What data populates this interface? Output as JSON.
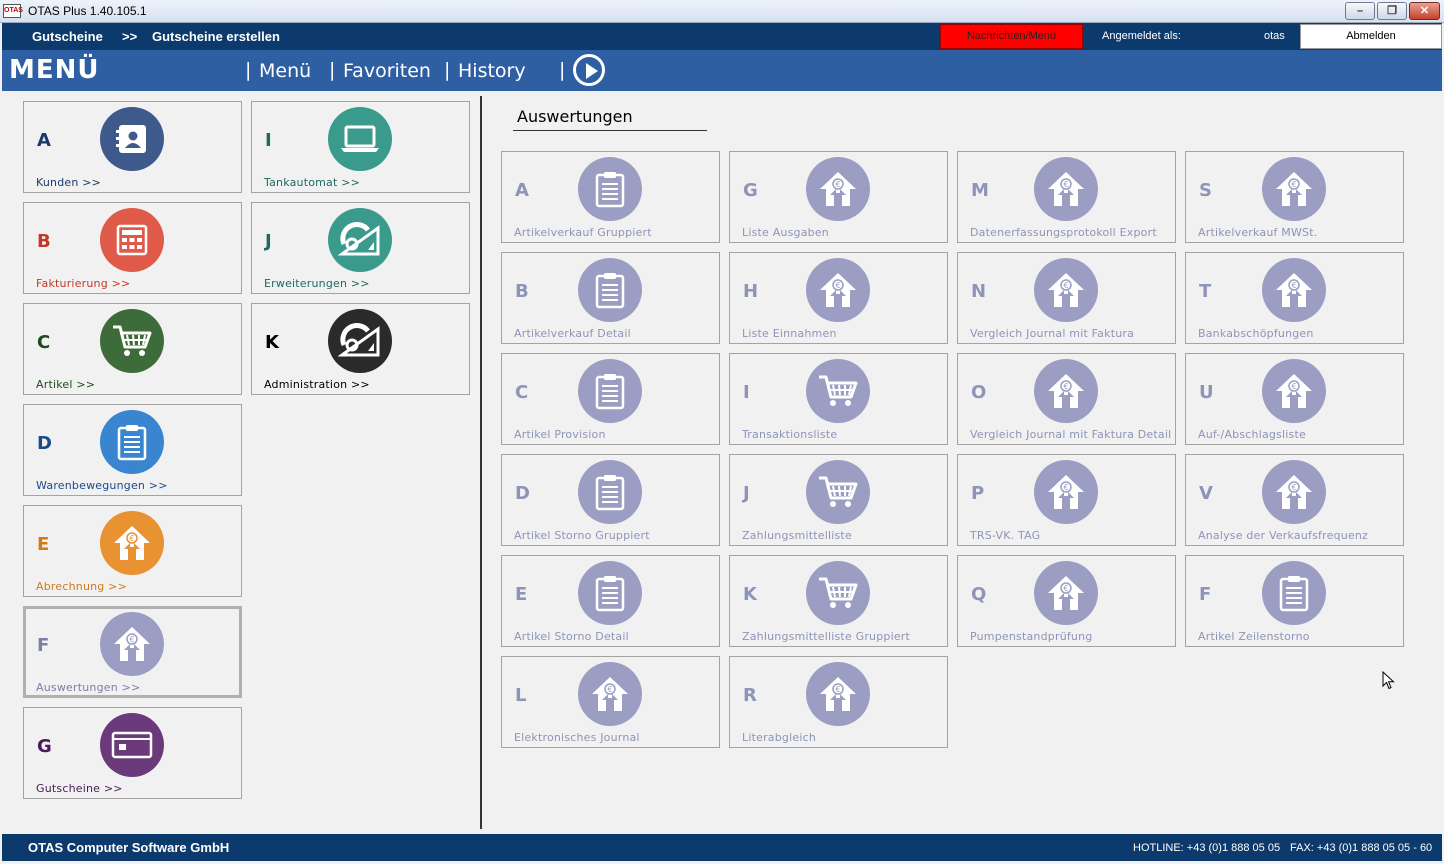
{
  "window": {
    "title": "OTAS Plus 1.40.105.1"
  },
  "topbar": {
    "crumb_1": "Gutscheine",
    "crumb_sep": ">>",
    "crumb_2": "Gutscheine erstellen",
    "messages_button": "Nachrichten/Menü",
    "logged_in_label": "Angemeldet als:",
    "user": "otas",
    "logout_button": "Abmelden"
  },
  "menubar": {
    "brand": "MENÜ",
    "separator": "|",
    "links": [
      "Menü",
      "Favoriten",
      "History"
    ]
  },
  "left_tiles": [
    {
      "letter": "A",
      "label": "Kunden >>",
      "icon": "contact-card-icon",
      "color": "#3e5a8a",
      "text_color": "#1a3b6a"
    },
    {
      "letter": "I",
      "label": "Tankautomat >>",
      "icon": "laptop-icon",
      "color": "#3a9a8c",
      "text_color": "#1f6a60"
    },
    {
      "letter": "B",
      "label": "Fakturierung >>",
      "icon": "calculator-icon",
      "color": "#e05a4a",
      "text_color": "#c0392b"
    },
    {
      "letter": "J",
      "label": "Erweiterungen >>",
      "icon": "protractor-icon",
      "color": "#3a9a8c",
      "text_color": "#1f6a60"
    },
    {
      "letter": "C",
      "label": "Artikel >>",
      "icon": "cart-icon",
      "color": "#3e6b3a",
      "text_color": "#1e4a1a"
    },
    {
      "letter": "K",
      "label": "Administration >>",
      "icon": "protractor-icon",
      "color": "#2a2a2a",
      "text_color": "#000000"
    },
    {
      "letter": "D",
      "label": "Warenbewegungen >>",
      "icon": "clipboard-icon",
      "color": "#3a85d0",
      "text_color": "#1a4a8a"
    },
    {
      "letter": "E",
      "label": "Abrechnung >>",
      "icon": "money-house-icon",
      "color": "#e89232",
      "text_color": "#d07a1a"
    },
    {
      "letter": "F",
      "label": "Auswertungen >>",
      "icon": "money-house-icon",
      "color": "#9b9ec2",
      "text_color": "#7a7fa8"
    },
    {
      "letter": "G",
      "label": "Gutscheine >>",
      "icon": "voucher-card-icon",
      "color": "#6a3a7a",
      "text_color": "#4a1a5a"
    }
  ],
  "section": {
    "title": "Auswertungen"
  },
  "report_tiles": [
    {
      "letter": "A",
      "label": "Artikelverkauf Gruppiert",
      "icon": "clipboard-icon"
    },
    {
      "letter": "G",
      "label": "Liste Ausgaben",
      "icon": "money-house-icon"
    },
    {
      "letter": "M",
      "label": "Datenerfassungsprotokoll Export",
      "icon": "money-house-icon"
    },
    {
      "letter": "S",
      "label": "Artikelverkauf MWSt.",
      "icon": "money-house-icon"
    },
    {
      "letter": "B",
      "label": "Artikelverkauf Detail",
      "icon": "clipboard-icon"
    },
    {
      "letter": "H",
      "label": "Liste Einnahmen",
      "icon": "money-house-icon"
    },
    {
      "letter": "N",
      "label": "Vergleich Journal mit Faktura",
      "icon": "money-house-icon"
    },
    {
      "letter": "T",
      "label": "Bankabschöpfungen",
      "icon": "money-house-icon"
    },
    {
      "letter": "C",
      "label": "Artikel Provision",
      "icon": "clipboard-icon"
    },
    {
      "letter": "I",
      "label": "Transaktionsliste",
      "icon": "cart-icon"
    },
    {
      "letter": "O",
      "label": "Vergleich Journal mit Faktura Detail",
      "icon": "money-house-icon"
    },
    {
      "letter": "U",
      "label": "Auf-/Abschlagsliste",
      "icon": "money-house-icon"
    },
    {
      "letter": "D",
      "label": "Artikel Storno Gruppiert",
      "icon": "clipboard-icon"
    },
    {
      "letter": "J",
      "label": "Zahlungsmittelliste",
      "icon": "cart-icon"
    },
    {
      "letter": "P",
      "label": "TRS-VK. TAG",
      "icon": "money-house-icon"
    },
    {
      "letter": "V",
      "label": "Analyse der Verkaufsfrequenz",
      "icon": "money-house-icon"
    },
    {
      "letter": "E",
      "label": "Artikel Storno Detail",
      "icon": "clipboard-icon"
    },
    {
      "letter": "K",
      "label": "Zahlungsmittelliste Gruppiert",
      "icon": "cart-icon"
    },
    {
      "letter": "Q",
      "label": "Pumpenstandprüfung",
      "icon": "money-house-icon"
    },
    {
      "letter": "F",
      "label": "Artikel Zeilenstorno",
      "icon": "clipboard-icon"
    },
    {
      "letter": "L",
      "label": "Elektronisches Journal",
      "icon": "money-house-icon"
    },
    {
      "letter": "R",
      "label": "Literabgleich",
      "icon": "money-house-icon"
    }
  ],
  "footer": {
    "company": "OTAS Computer Software GmbH",
    "hotline": "HOTLINE: +43 (0)1 888 05 05",
    "fax": "FAX: +43 (0)1 888 05 05 - 60"
  }
}
